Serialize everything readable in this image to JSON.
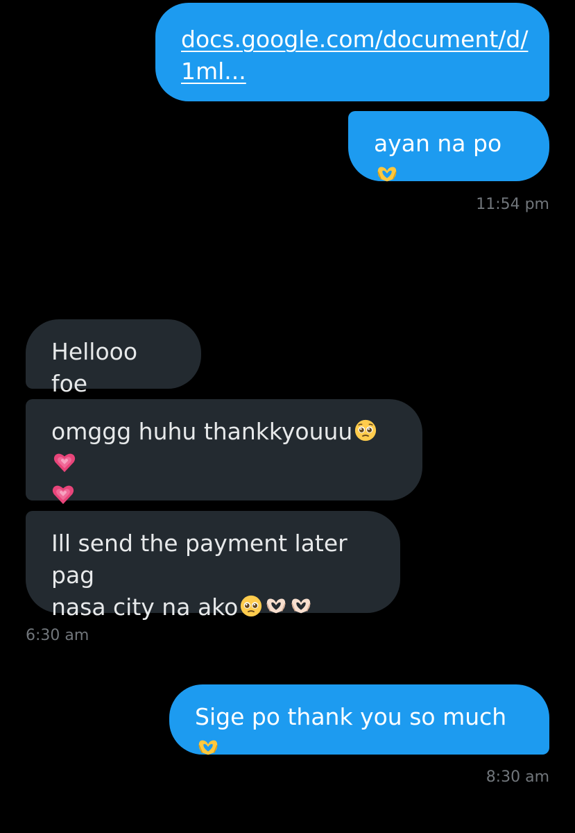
{
  "conversation": {
    "messages": [
      {
        "direction": "sent",
        "text_line1": "docs.google.com/document/d/",
        "text_line2": "1ml..."
      },
      {
        "direction": "sent",
        "text": "ayan na po",
        "emojis": [
          "heart-hands-icon"
        ]
      },
      {
        "timestamp": "11:54 pm"
      },
      {
        "direction": "received",
        "text": "Hellooo foe"
      },
      {
        "direction": "received",
        "text": "omggg huhu thankkyouuu",
        "emojis": [
          "pleading-face-icon",
          "growing-heart-icon",
          "growing-heart-icon"
        ]
      },
      {
        "direction": "received",
        "text_line1": "Ill send the payment later pag",
        "text_line2": "nasa city na ako",
        "emojis": [
          "pleading-face-icon",
          "heart-hands-light-icon",
          "heart-hands-light-icon"
        ]
      },
      {
        "timestamp": "6:30 am"
      },
      {
        "direction": "sent",
        "text": "Sige po thank you so much ",
        "emojis": [
          "heart-hands-icon"
        ]
      },
      {
        "timestamp": "8:30 am"
      }
    ]
  },
  "colors": {
    "background": "#000000",
    "sent_bubble": "#1d9bf0",
    "received_bubble": "#232a30",
    "timestamp": "#71767b"
  }
}
